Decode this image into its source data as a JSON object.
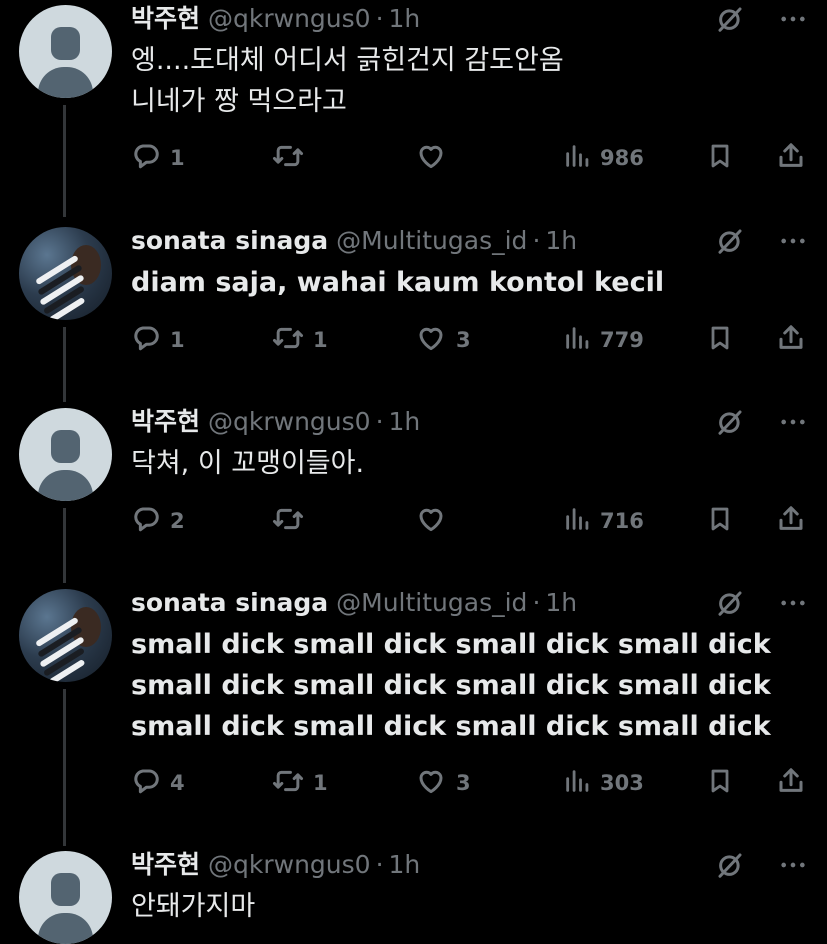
{
  "colors": {
    "background": "#000000",
    "primary_text": "#e7e9ea",
    "secondary_text": "#71767b",
    "thread_line": "#333639",
    "default_avatar_bg": "#cfd9de",
    "default_avatar_fg": "#536471"
  },
  "tweets": [
    {
      "author": "박주현",
      "handle": "@qkrwngus0",
      "separator": "·",
      "time": "1h",
      "avatar": "default-profile-avatar",
      "lines": [
        "엥....도대체 어디서 긁힌건지 감도안옴",
        "니네가 짱 먹으라고"
      ],
      "replies": "1",
      "retweets": "",
      "likes": "",
      "views": "986"
    },
    {
      "author": "sonata sinaga",
      "handle": "@Multitugas_id",
      "separator": "·",
      "time": "1h",
      "avatar": "zebra-photo-avatar",
      "lines": [
        "diam saja, wahai kaum kontol kecil"
      ],
      "replies": "1",
      "retweets": "1",
      "likes": "3",
      "views": "779"
    },
    {
      "author": "박주현",
      "handle": "@qkrwngus0",
      "separator": "·",
      "time": "1h",
      "avatar": "default-profile-avatar",
      "lines": [
        "닥쳐, 이 꼬맹이들아."
      ],
      "replies": "2",
      "retweets": "",
      "likes": "",
      "views": "716"
    },
    {
      "author": "sonata sinaga",
      "handle": "@Multitugas_id",
      "separator": "·",
      "time": "1h",
      "avatar": "zebra-photo-avatar",
      "lines": [
        "small dick small dick small dick small dick",
        "small dick small dick small dick small dick",
        "small dick small dick small dick small dick"
      ],
      "replies": "4",
      "retweets": "1",
      "likes": "3",
      "views": "303"
    },
    {
      "author": "박주현",
      "handle": "@qkrwngus0",
      "separator": "·",
      "time": "1h",
      "avatar": "default-profile-avatar",
      "lines": [
        "안돼가지마"
      ],
      "replies": "",
      "retweets": "",
      "likes": "",
      "views": ""
    }
  ],
  "icons": {
    "grok": "grok-slash-circle-icon",
    "more": "more-dots-icon",
    "reply": "reply-bubble-icon",
    "retweet": "retweet-arrows-icon",
    "like": "heart-icon",
    "views": "views-bars-icon",
    "bookmark": "bookmark-icon",
    "share": "share-upload-icon"
  }
}
